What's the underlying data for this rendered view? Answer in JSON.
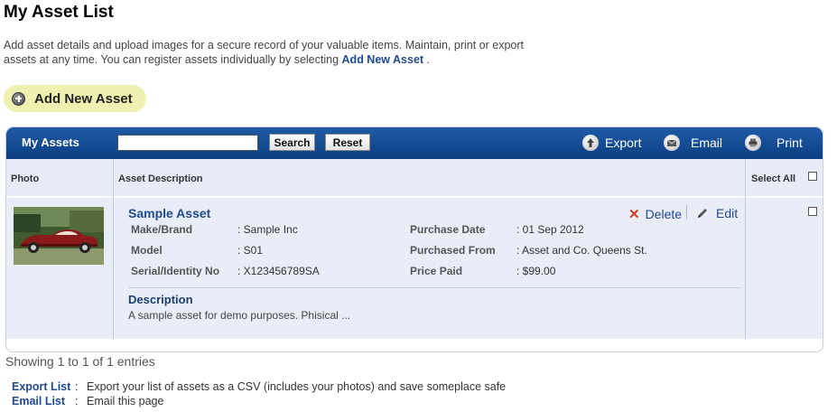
{
  "page": {
    "title": "My Asset List",
    "intro_text": "Add asset details and upload images for a secure record of your valuable items. Maintain, print or export assets at any time. You can register assets individually by selecting",
    "intro_link": "Add New Asset",
    "intro_end": ".",
    "add_button_label": "Add New Asset"
  },
  "toolbar": {
    "title": "My Assets",
    "search_value": "",
    "search_button": "Search",
    "reset_button": "Reset",
    "export_label": "Export",
    "email_label": "Email",
    "print_label": "Print"
  },
  "table": {
    "headers": {
      "photo": "Photo",
      "description": "Asset Description",
      "select_all": "Select All"
    },
    "row": {
      "photo_icon": "vintage-red-car-photo",
      "title": "Sample Asset",
      "delete_label": "Delete",
      "edit_label": "Edit",
      "left_fields": [
        {
          "label": "Make/Brand",
          "value": ": Sample Inc"
        },
        {
          "label": "Model",
          "value": ": S01"
        },
        {
          "label": "Serial/Identity No",
          "value": ": X123456789SA"
        }
      ],
      "right_fields": [
        {
          "label": "Purchase Date",
          "value": ": 01 Sep 2012"
        },
        {
          "label": "Purchased From",
          "value": ": Asset and Co. Queens St."
        },
        {
          "label": "Price Paid",
          "value": ": $99.00"
        }
      ],
      "description_title": "Description",
      "description_text": "A sample asset for demo purposes. Phisical ..."
    }
  },
  "footer": {
    "showing": "Showing 1 to 1 of 1 entries",
    "links": [
      {
        "label": "Export List",
        "colon": ":",
        "text": "Export your list of assets as a CSV (includes your photos) and save someplace safe"
      },
      {
        "label": "Email List",
        "colon": ":",
        "text": "Email this page"
      }
    ]
  },
  "colors": {
    "toolbar_blue": "#0b3e82",
    "link_blue": "#1f4a8c",
    "row_bg": "#e9edf8",
    "add_button_bg": "#eef1b0",
    "delete_red": "#d13a2a"
  }
}
